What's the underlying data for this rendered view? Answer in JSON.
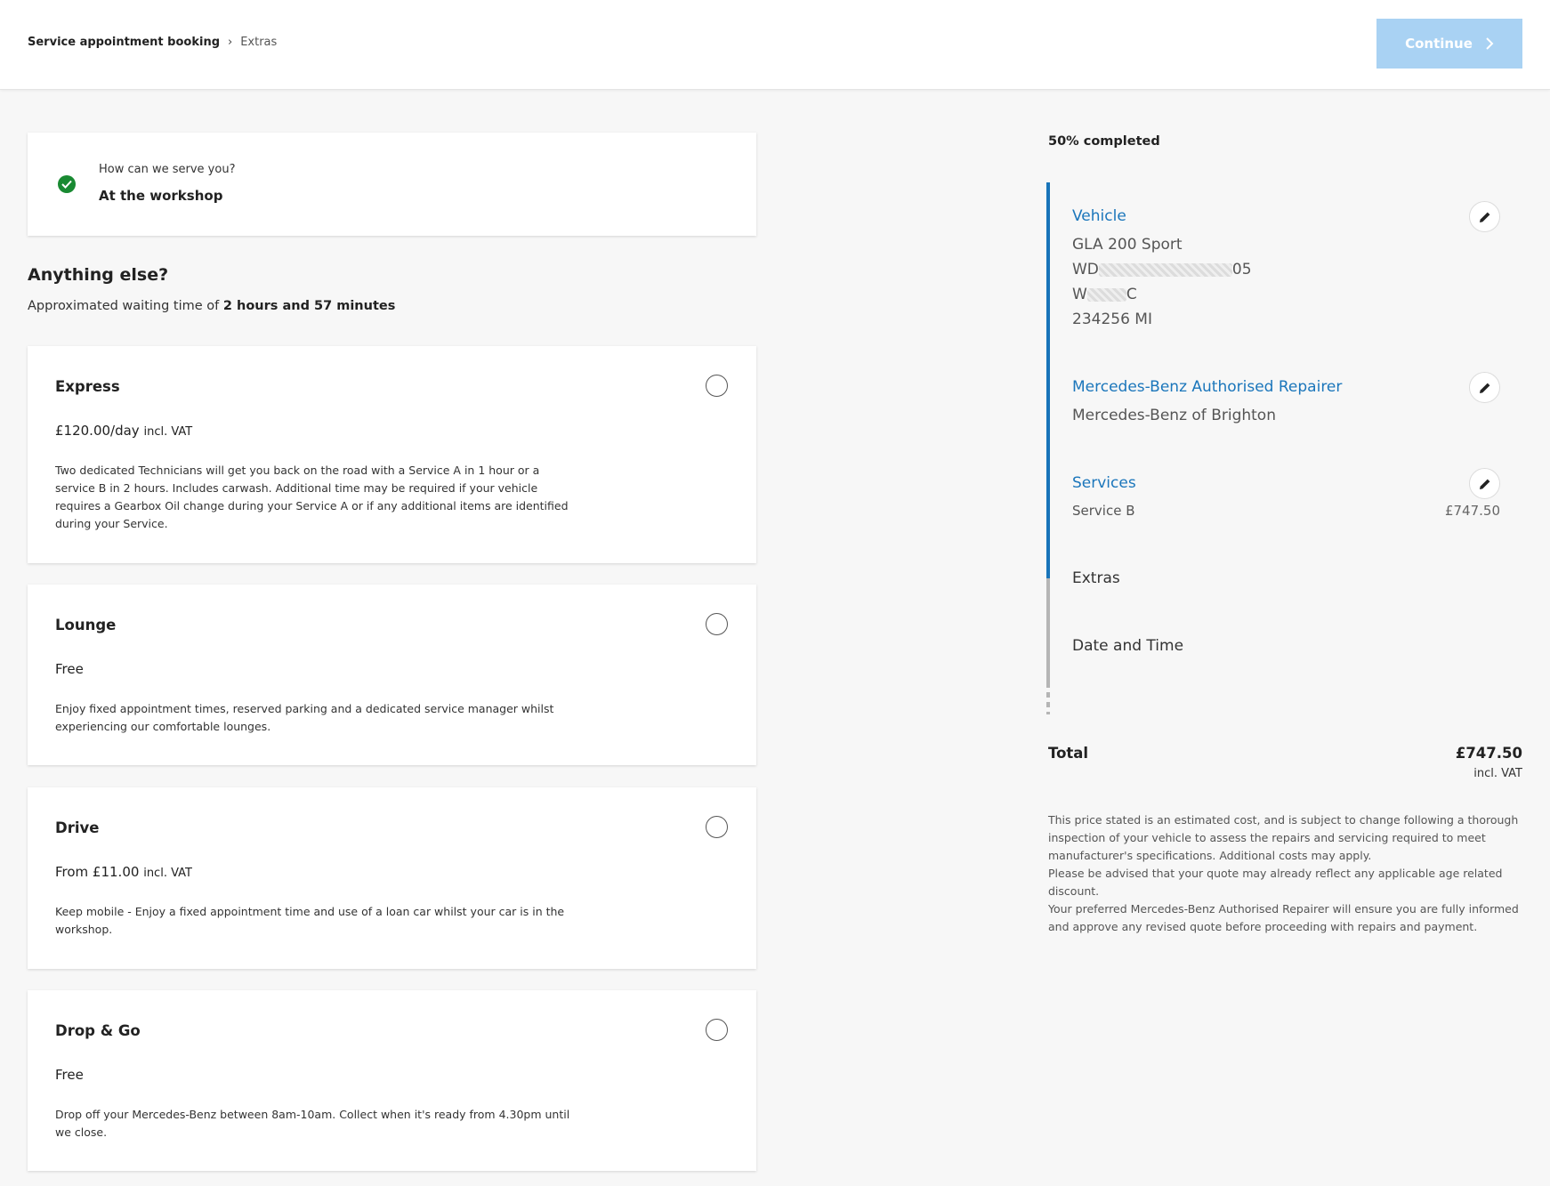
{
  "header": {
    "breadcrumb": [
      "Service appointment booking",
      "Extras"
    ],
    "breadcrumb_separator": "›",
    "continue_label": "Continue",
    "continue_enabled": false
  },
  "serve": {
    "question": "How can we serve you?",
    "answer": "At the workshop",
    "status_color": "#198a32"
  },
  "extras": {
    "title": "Anything else?",
    "waiting_prefix": "Approximated waiting time of ",
    "waiting_value": "2 hours and 57 minutes",
    "options": [
      {
        "title": "Express",
        "price": "£120.00/day",
        "vat": "incl. VAT",
        "description": "Two dedicated Technicians will get you back on the road with a Service A in 1 hour or a service B in 2 hours. Includes carwash. Additional time may be required if your vehicle requires a Gearbox Oil change during your Service A or if any additional items are identified during your Service.",
        "selected": false
      },
      {
        "title": "Lounge",
        "price": "Free",
        "vat": "",
        "description": "Enjoy fixed appointment times, reserved parking and a dedicated service manager whilst experiencing our comfortable lounges.",
        "selected": false
      },
      {
        "title": "Drive",
        "price": "From £11.00",
        "vat": "incl. VAT",
        "description": "Keep mobile - Enjoy a fixed appointment time and use of a loan car whilst your car is in the workshop.",
        "selected": false
      },
      {
        "title": "Drop & Go",
        "price": "Free",
        "vat": "",
        "description": "Drop off your Mercedes-Benz between 8am-10am. Collect when it's ready from 4.30pm until we close.",
        "selected": false
      }
    ]
  },
  "summary": {
    "progress_label": "50% completed",
    "progress_percent": 50,
    "accent_color": "#1874b9",
    "vehicle": {
      "title": "Vehicle",
      "model": "GLA 200 Sport",
      "vin_prefix": "WD",
      "vin_suffix": "05",
      "reg_prefix": "W",
      "reg_suffix": "C",
      "mileage": "234256 MI"
    },
    "repairer": {
      "title": "Mercedes-Benz Authorised Repairer",
      "name": "Mercedes-Benz of Brighton"
    },
    "services": {
      "title": "Services",
      "item": "Service B",
      "price": "£747.50"
    },
    "extras_label": "Extras",
    "datetime_label": "Date and Time",
    "total_label": "Total",
    "total_value": "£747.50",
    "total_vat": "incl. VAT",
    "disclaimer": [
      "This price stated is an estimated cost, and is subject to change following a thorough inspection of your vehicle to assess the repairs and servicing required to meet manufacturer's specifications. Additional costs may apply.",
      "Please be advised that your quote may already reflect any applicable age related discount.",
      "Your preferred Mercedes-Benz Authorised Repairer will ensure you are fully informed and approve any revised quote before proceeding with repairs and payment."
    ]
  }
}
